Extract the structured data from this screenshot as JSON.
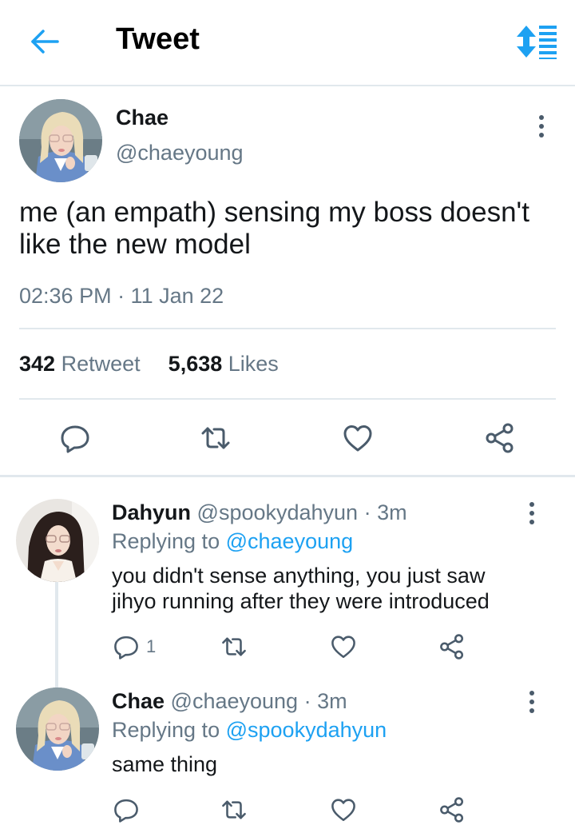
{
  "header": {
    "title": "Tweet",
    "back_icon": "arrow-left-icon",
    "sort_icon": "sort-icon"
  },
  "main": {
    "name": "Chae",
    "handle": "@chaeyoung",
    "text_line1": "me (an empath) sensing my boss doesn't",
    "text_line2": "like the new model",
    "timestamp": "02:36 PM · 11 Jan 22",
    "retweet_count": "342",
    "retweet_label": "Retweet",
    "like_count": "5,638",
    "like_label": "Likes"
  },
  "replies": [
    {
      "name": "Dahyun",
      "handle": "@spookydahyun",
      "age": "· 3m",
      "replying_label": "Replying to",
      "replying_to": "@chaeyoung",
      "text_line1": "you didn't sense anything, you just saw",
      "text_line2": "jihyo running after they were introduced",
      "reply_count": "1"
    },
    {
      "name": "Chae",
      "handle": "@chaeyoung",
      "age": "· 3m",
      "replying_label": "Replying to",
      "replying_to": "@spookydahyun",
      "text_line1": "same thing",
      "reply_count": ""
    }
  ],
  "colors": {
    "accent": "#1da1f2",
    "secondary_text": "#657786",
    "icon": "#4a5b6b",
    "divider": "#e1e8ed"
  }
}
